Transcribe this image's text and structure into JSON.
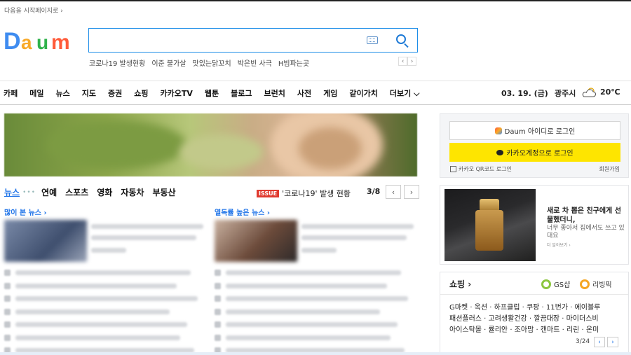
{
  "top": {
    "start_page_link": "다음을 시작페이지로 ›"
  },
  "logo": {
    "alt": "Daum"
  },
  "search": {
    "value": "",
    "placeholder": ""
  },
  "trending": {
    "keywords": [
      "코로나19 발생현황",
      "이준 불가살",
      "맛있는닭꼬치",
      "박은빈 사극",
      "H빔파는곳"
    ],
    "prev": "‹",
    "next": "›"
  },
  "nav": {
    "items": [
      "카페",
      "메일",
      "뉴스",
      "지도",
      "증권",
      "쇼핑",
      "카카오TV",
      "웹툰",
      "블로그",
      "브런치",
      "사전",
      "게임",
      "같이가치",
      "더보기 ⌵"
    ],
    "date": "03. 19. (금)",
    "city": "광주시",
    "temp": "20℃",
    "weather_icon": "cloud-sun-icon"
  },
  "news": {
    "tabs": [
      "뉴스",
      "연예",
      "스포츠",
      "영화",
      "자동차",
      "부동산"
    ],
    "dots": "•••",
    "issue_badge": "ISSUE",
    "issue_text": "'코로나19' 발생 현황",
    "issue_count": "3/8",
    "prev": "‹",
    "next": "›",
    "most_viewed": "많이 본 뉴스 ›",
    "most_commented": "열독률 높은 뉴스 ›"
  },
  "login": {
    "daum_label": "Daum 아이디로 로그인",
    "kakao_label": "카카오계정으로 로그인",
    "qr_label": "카카오 QR코드 로그인",
    "signup_label": "회원가입"
  },
  "ad": {
    "title": "새로 차 뽑은 친구에게 선물했더니,",
    "desc": "너무 좋아서 집에서도 쓰고 있대요",
    "more": "더 알아보기 ›"
  },
  "shopping": {
    "title": "쇼핑 ›",
    "brands": [
      {
        "label": "GS샵",
        "color": "#8cc63f"
      },
      {
        "label": "리빙픽",
        "color": "#f5a623"
      }
    ],
    "rows": [
      "G마켓 · 옥션 · 하프클럽 · 쿠팡 · 11번가 · 에이블루",
      "패션플러스 · 고려생활건강 · 깔끔대장 · 마이더스비",
      "아이스탁몰 · 률리안 · 조아맘 · 캔마트 · 리린 · 온미"
    ],
    "page": "3/24",
    "prev": "‹",
    "next": "›"
  }
}
